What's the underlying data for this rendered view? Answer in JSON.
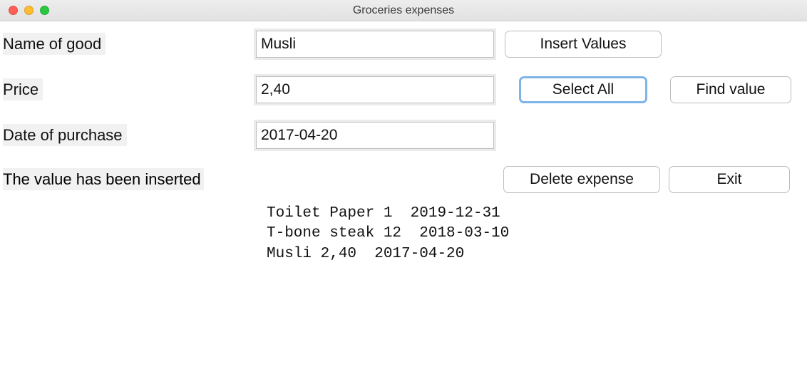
{
  "window": {
    "title": "Groceries expenses"
  },
  "labels": {
    "name": "Name of good",
    "price": "Price",
    "date": "Date of purchase"
  },
  "inputs": {
    "name": "Musli",
    "price": "2,40",
    "date": "2017-04-20"
  },
  "buttons": {
    "insert": "Insert Values",
    "select_all": "Select All",
    "find": "Find value",
    "delete": "Delete expense",
    "exit": "Exit"
  },
  "status": "The value has been inserted",
  "list_text": "Toilet Paper 1  2019-12-31\nT-bone steak 12  2018-03-10\nMusli 2,40  2017-04-20"
}
